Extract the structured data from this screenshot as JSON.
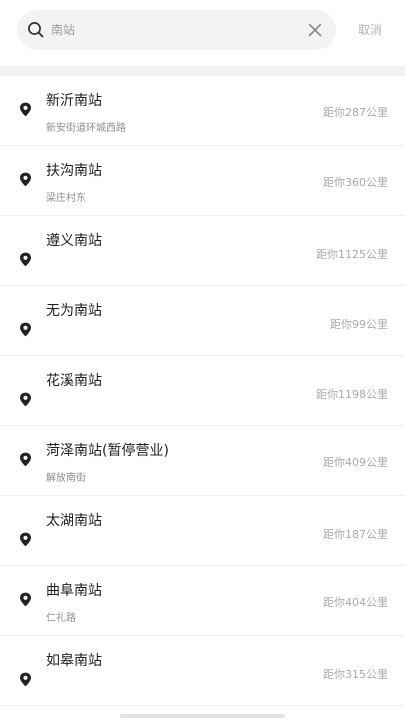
{
  "search": {
    "value": "南站",
    "cancel_label": "取消"
  },
  "stations": [
    {
      "name": "新沂南站",
      "address": "新安街道环城西路",
      "distance": "距你287公里"
    },
    {
      "name": "扶沟南站",
      "address": "梁庄村东",
      "distance": "距你360公里"
    },
    {
      "name": "遵义南站",
      "address": "",
      "distance": "距你1125公里"
    },
    {
      "name": "无为南站",
      "address": "",
      "distance": "距你99公里"
    },
    {
      "name": "花溪南站",
      "address": "",
      "distance": "距你1198公里"
    },
    {
      "name": "菏泽南站(暂停营业)",
      "address": "解放南街",
      "distance": "距你409公里"
    },
    {
      "name": "太湖南站",
      "address": "",
      "distance": "距你187公里"
    },
    {
      "name": "曲阜南站",
      "address": "仁礼路",
      "distance": "距你404公里"
    },
    {
      "name": "如皋南站",
      "address": "",
      "distance": "距你315公里"
    }
  ],
  "icons": {
    "search": "search-icon",
    "clear": "close-icon",
    "station": "location-pin-icon"
  },
  "colors": {
    "text_primary": "#1f1f1f",
    "text_secondary": "#8e8e8e",
    "distance": "#a9a9a9",
    "search_bg": "#f3f3f5"
  }
}
